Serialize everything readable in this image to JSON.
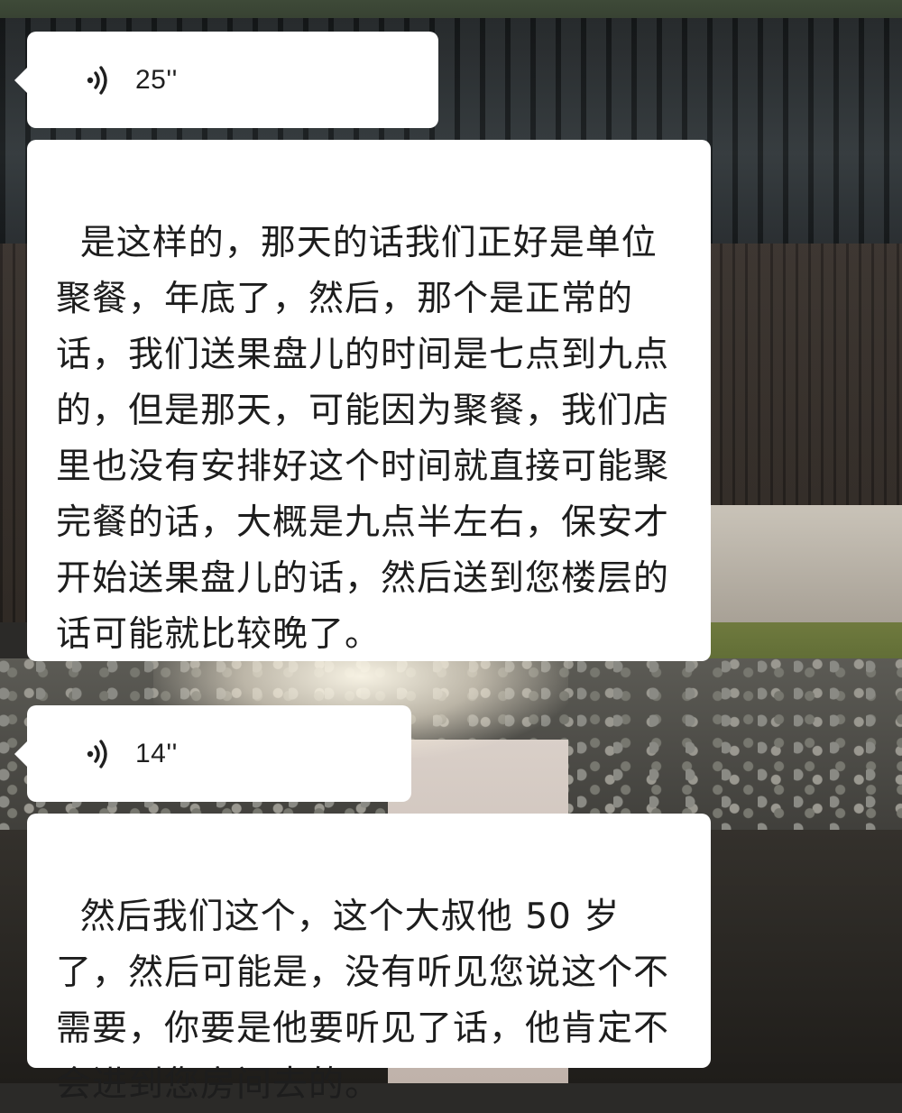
{
  "messages": [
    {
      "type": "voice",
      "duration": "25''"
    },
    {
      "type": "text",
      "text": "是这样的，那天的话我们正好是单位聚餐，年底了，然后，那个是正常的话，我们送果盘儿的时间是七点到九点的，但是那天，可能因为聚餐，我们店里也没有安排好这个时间就直接可能聚完餐的话，大概是九点半左右，保安才开始送果盘儿的话，然后送到您楼层的话可能就比较晚了。"
    },
    {
      "type": "voice",
      "duration": "14''"
    },
    {
      "type": "text",
      "text": "然后我们这个，这个大叔他 50 岁了，然后可能是，没有听见您说这个不需要，你要是他要听见了话，他肯定不会进到您房间去的。"
    }
  ],
  "icons": {
    "voice": "voice-wave-icon"
  }
}
